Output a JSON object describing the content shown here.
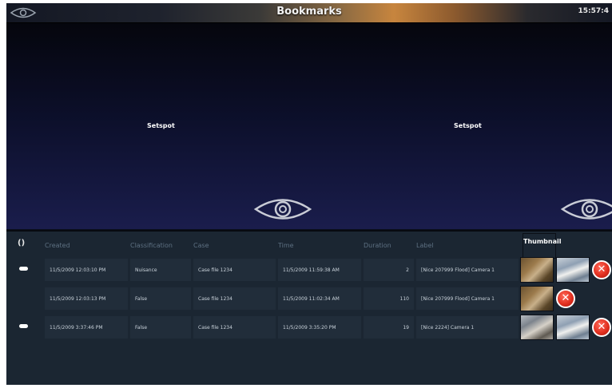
{
  "window": {
    "title": "Bookmarks",
    "clock": "15:57:4"
  },
  "video": {
    "panes": [
      {
        "label": "Setspot"
      },
      {
        "label": "Setspot"
      }
    ]
  },
  "table": {
    "sort_toggle": "()",
    "columns": [
      "Created",
      "Classification",
      "Case",
      "Time",
      "Duration",
      "Label",
      "Thumbnail"
    ],
    "rows": [
      {
        "marked": true,
        "created": "11/5/2009 12:03:10 PM",
        "classification": "Nuisance",
        "case": "Case file 1234",
        "time": "11/5/2009 11:59:38 AM",
        "duration": "2",
        "label": "[Nice 207999 Flood] Camera 1",
        "thumbnails": [
          "warehouse-photo",
          "office-photo"
        ]
      },
      {
        "marked": false,
        "created": "11/5/2009 12:03:13 PM",
        "classification": "False",
        "case": "Case file 1234",
        "time": "11/5/2009 11:02:34 AM",
        "duration": "110",
        "label": "[Nice 207999 Flood] Camera 1",
        "thumbnails": [
          "warehouse-photo"
        ]
      },
      {
        "marked": true,
        "created": "11/5/2009 3:37:46 PM",
        "classification": "False",
        "case": "Case file 1234",
        "time": "11/5/2009 3:35:20 PM",
        "duration": "19",
        "label": "[Nice 2224] Camera 1",
        "thumbnails": [
          "lobby-photo",
          "office-photo"
        ]
      }
    ]
  },
  "icons": {
    "delete": "delete-icon",
    "logo": "eye-logo-icon",
    "marker": "bookmark-marker-icon"
  },
  "colors": {
    "accent": "#c7853e",
    "delete": "#e23020",
    "background": "#0b0f1c",
    "table": "#1b2632"
  }
}
